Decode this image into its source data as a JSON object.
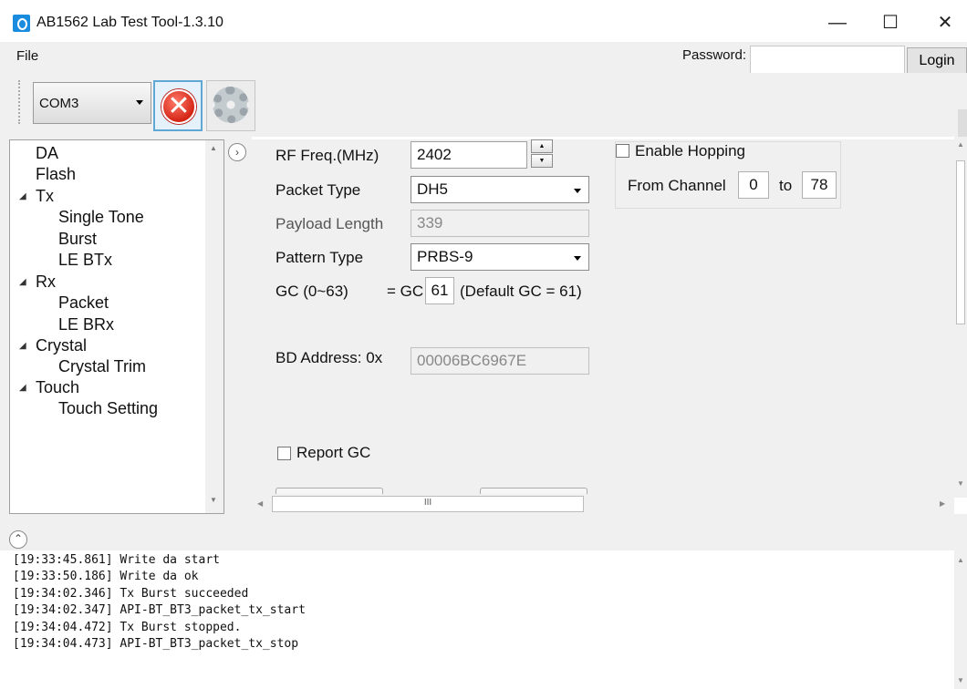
{
  "window": {
    "title": "AB1562 Lab Test Tool-1.3.10",
    "minimize": "—",
    "maximize": "☐",
    "close": "✕"
  },
  "menu": {
    "file": "File",
    "password_label": "Password:",
    "password_value": "",
    "login_label": "Login"
  },
  "toolbar": {
    "com_port": "COM3",
    "disconnect_glyph": "✕"
  },
  "tree": {
    "items": [
      {
        "label": "DA"
      },
      {
        "label": "Flash"
      },
      {
        "label": "Tx",
        "expander": "◢"
      },
      {
        "label": "Single Tone"
      },
      {
        "label": "Burst"
      },
      {
        "label": "LE BTx"
      },
      {
        "label": "Rx",
        "expander": "◢"
      },
      {
        "label": "Packet"
      },
      {
        "label": "LE BRx"
      },
      {
        "label": "Crystal",
        "expander": "◢"
      },
      {
        "label": "Crystal Trim"
      },
      {
        "label": "Touch",
        "expander": "◢"
      },
      {
        "label": "Touch Setting"
      }
    ],
    "collapse_glyph": "›"
  },
  "form": {
    "rf_freq_label": "RF Freq.(MHz)",
    "rf_freq_value": "2402",
    "packet_type_label": "Packet Type",
    "packet_type_value": "DH5",
    "payload_length_label": "Payload Length",
    "payload_length_value": "339",
    "pattern_type_label": "Pattern Type",
    "pattern_type_value": "PRBS-9",
    "gc_label": "GC (0~63)",
    "gc_prefix": "= GC",
    "gc_value": "61",
    "gc_default": "(Default GC = 61)",
    "bd_address_label": "BD Address: 0x",
    "bd_address_value": "00006BC6967E",
    "report_gc_label": "Report GC",
    "enable_hopping_label": "Enable Hopping",
    "from_channel_label": "From Channel",
    "from_channel_value": "0",
    "to_label": "to",
    "to_channel_value": "78",
    "spin_up": "▲",
    "spin_down": "▼"
  },
  "scroll": {
    "hscroll_grip": "III"
  },
  "log": {
    "collapse_glyph": "⌃",
    "lines": [
      "[19:33:45.861] Write da start",
      "[19:33:50.186] Write da ok",
      "[19:34:02.346] Tx Burst succeeded",
      "[19:34:02.347] API-BT_BT3_packet_tx_start",
      "[19:34:04.472] Tx Burst stopped.",
      "[19:34:04.473] API-BT_BT3_packet_tx_stop"
    ]
  }
}
